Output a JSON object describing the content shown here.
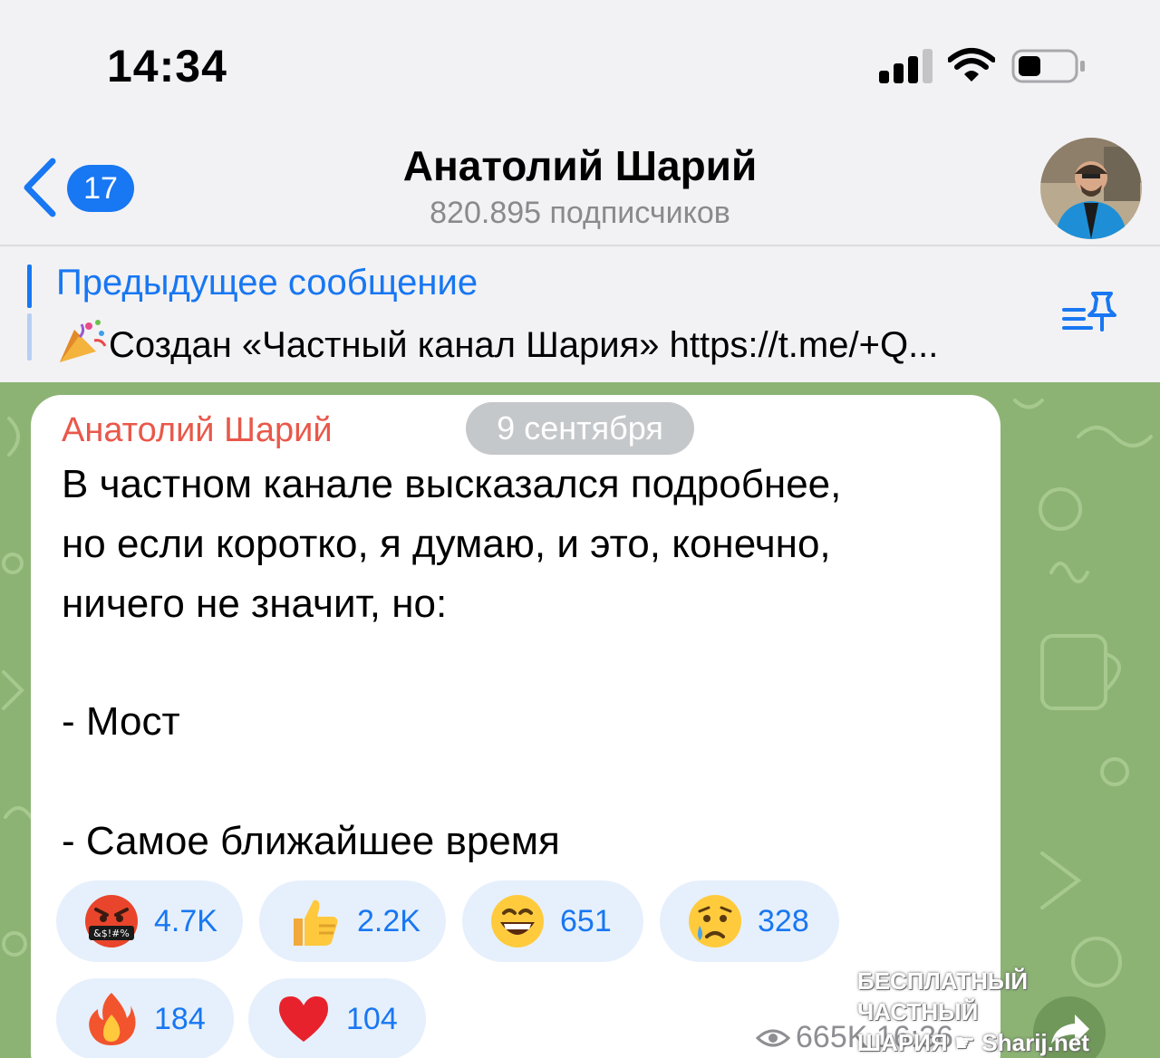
{
  "status_bar": {
    "time": "14:34"
  },
  "header": {
    "back_count": "17",
    "title": "Анатолий Шарий",
    "subtitle": "820.895 подписчиков"
  },
  "pinned": {
    "title": "Предыдущее сообщение",
    "text": "Создан «Частный канал Шария» https://t.me/+Q..."
  },
  "message": {
    "sender": "Анатолий Шарий",
    "date": "9 сентября",
    "lines": [
      "В частном канале высказался подробнее,",
      "но если коротко, я думаю, и это, конечно,",
      "ничего не значит, но:",
      "- Мост",
      "- Самое ближайшее время"
    ],
    "reactions": [
      {
        "emoji": "swearing-face",
        "count": "4.7K"
      },
      {
        "emoji": "thumbs-up",
        "count": "2.2K"
      },
      {
        "emoji": "grinning-face",
        "count": "651"
      },
      {
        "emoji": "crying-face",
        "count": "328"
      },
      {
        "emoji": "fire",
        "count": "184"
      },
      {
        "emoji": "red-heart",
        "count": "104"
      }
    ],
    "views": "665K",
    "time": "16:36"
  },
  "watermark": {
    "line1": "БЕСПЛАТНЫЙ ЧАСТНЫЙ",
    "line2": "ШАРИЯ",
    "line2_site": "Sharij.net"
  },
  "colors": {
    "accent": "#1877f2",
    "sender": "#e9584a",
    "chat_background": "#8cb374",
    "reaction_bg": "#e6f0fc"
  }
}
